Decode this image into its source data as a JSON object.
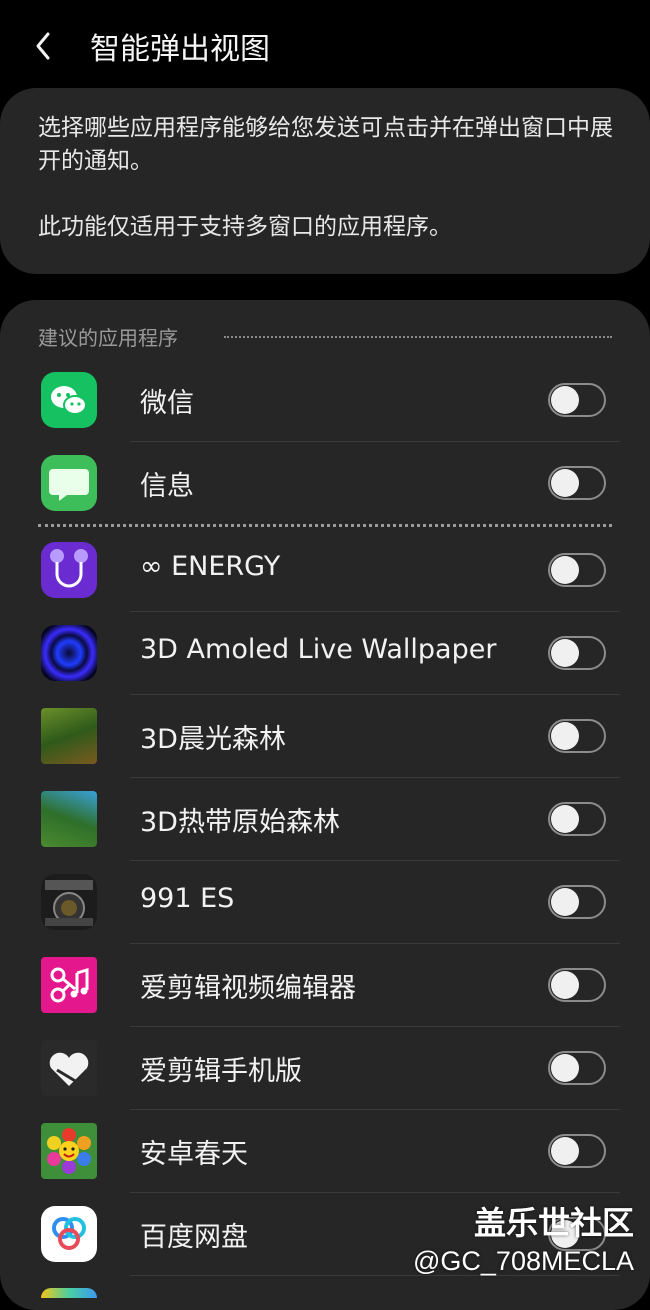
{
  "header": {
    "title": "智能弹出视图",
    "back_icon": "chevron-left-icon"
  },
  "info": {
    "line1": "选择哪些应用程序能够给您发送可点击并在弹出窗口中展开的通知。",
    "line2": "此功能仅适用于支持多窗口的应用程序。"
  },
  "suggested": {
    "header": "建议的应用程序"
  },
  "apps": [
    {
      "name": "微信",
      "icon": "wechat-icon",
      "enabled": false
    },
    {
      "name": "信息",
      "icon": "messages-icon",
      "enabled": false
    },
    {
      "name": "∞ ENERGY",
      "icon": "energy-icon",
      "enabled": false
    },
    {
      "name": "3D Amoled Live Wallpaper",
      "icon": "amoled-wallpaper-icon",
      "enabled": false
    },
    {
      "name": "3D晨光森林",
      "icon": "morning-forest-icon",
      "enabled": false
    },
    {
      "name": "3D热带原始森林",
      "icon": "tropical-forest-icon",
      "enabled": false
    },
    {
      "name": "991 ES",
      "icon": "calculator-icon",
      "enabled": false
    },
    {
      "name": "爱剪辑视频编辑器",
      "icon": "video-editor-icon",
      "enabled": false
    },
    {
      "name": "爱剪辑手机版",
      "icon": "video-editor-mobile-icon",
      "enabled": false
    },
    {
      "name": "安卓春天",
      "icon": "flower-icon",
      "enabled": false
    },
    {
      "name": "百度网盘",
      "icon": "baidu-netdisk-icon",
      "enabled": false
    }
  ],
  "watermark": {
    "line1": "盖乐世社区",
    "line2": "@GC_708MECLA"
  }
}
